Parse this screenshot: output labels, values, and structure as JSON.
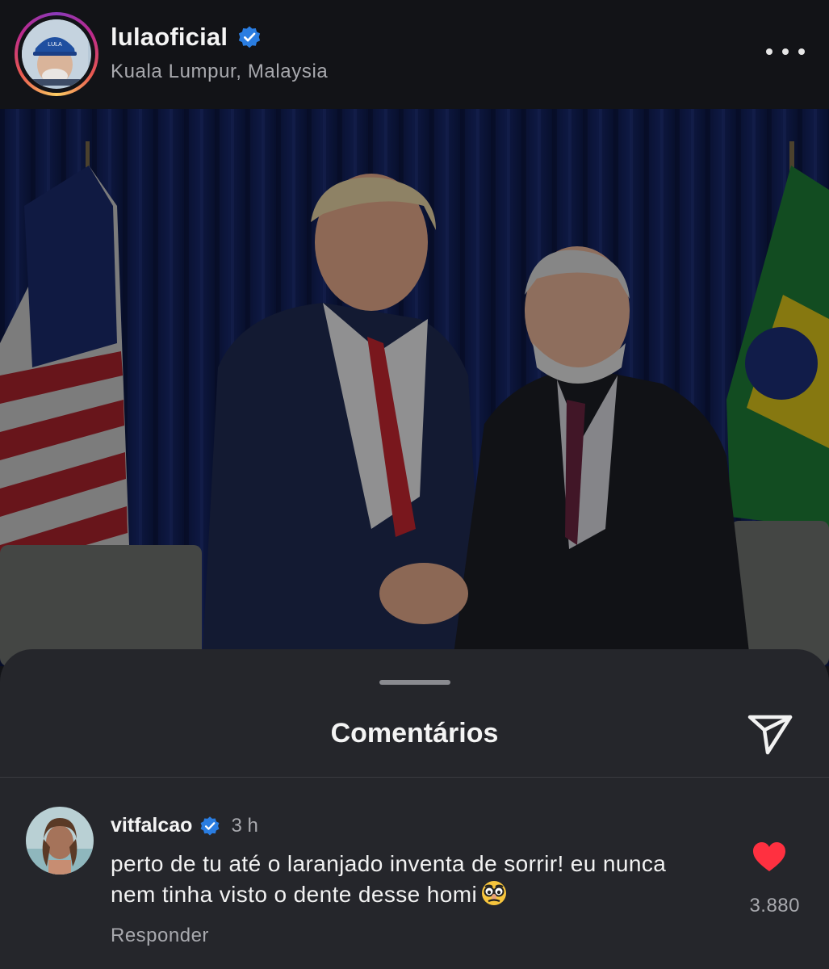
{
  "post": {
    "username": "lulaoficial",
    "location": "Kuala Lumpur, Malaysia",
    "verified": true,
    "image_alt": "Two men shaking hands in front of US and Brazil flags"
  },
  "sheet": {
    "title": "Comentários"
  },
  "comment": {
    "username": "vitfalcao",
    "verified": true,
    "time": "3 h",
    "text": "perto de tu até o laranjado inventa de sorrir! eu nunca nem tinha visto o dente desse homi",
    "emoji": "disguised-face-emoji",
    "reply_label": "Responder",
    "like_count": "3.880",
    "liked": true
  },
  "colors": {
    "background": "#121317",
    "sheet": "#25262b",
    "muted_text": "#a8a9ae",
    "like_red": "#ff3040",
    "verified_blue": "#2a7de1"
  }
}
